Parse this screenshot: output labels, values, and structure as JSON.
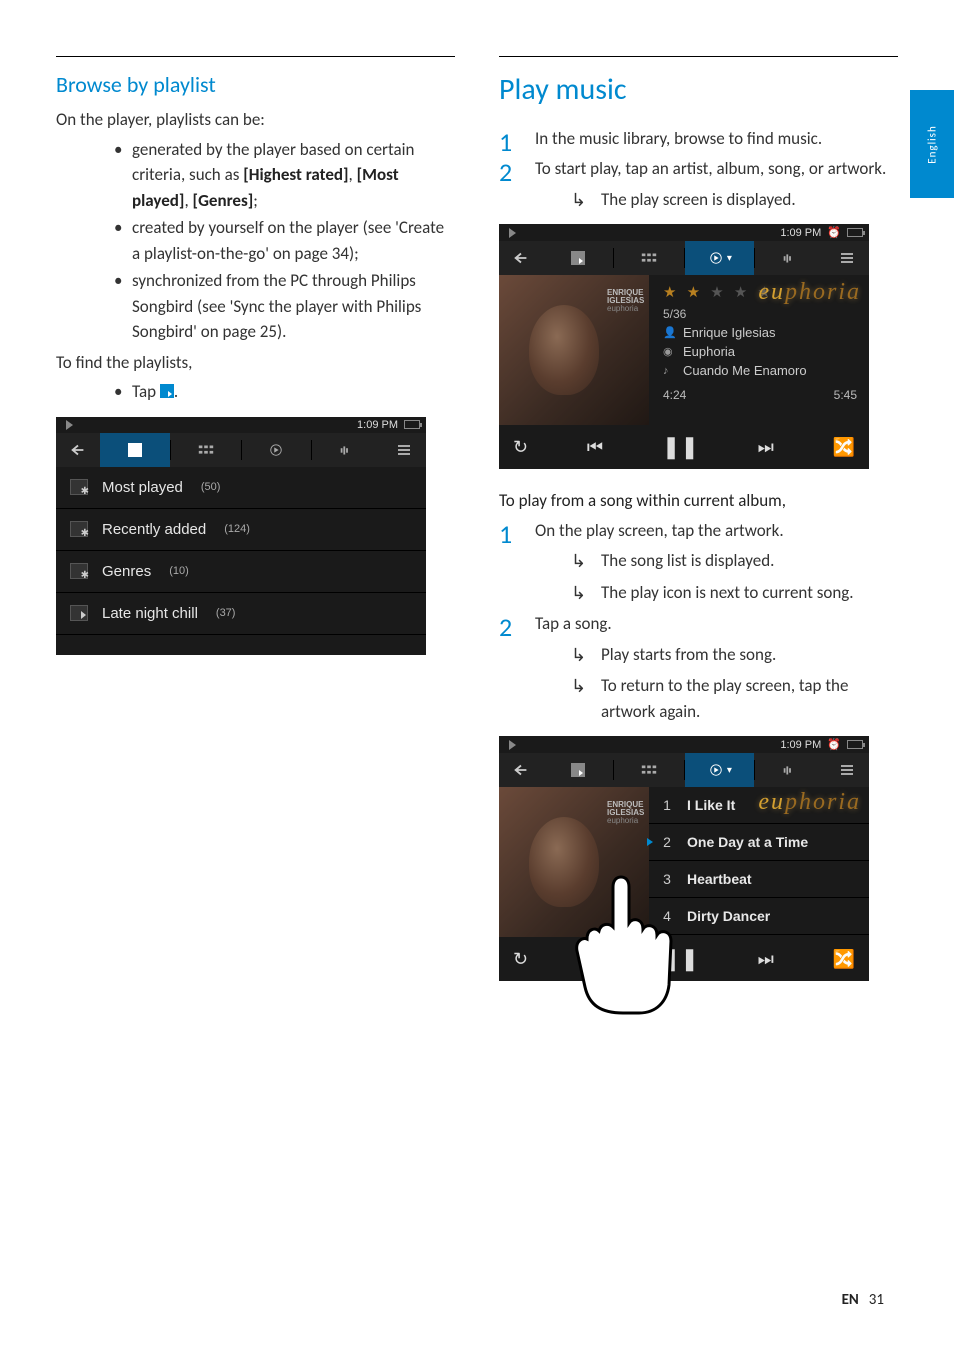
{
  "lang_tab": "English",
  "left": {
    "title": "Browse by playlist",
    "intro": "On the player, playlists can be:",
    "bullets": [
      {
        "pre": "generated by the player based on certain criteria, such as ",
        "bold": "[Highest rated]",
        "mid": ", ",
        "bold2": "[Most played]",
        "mid2": ", ",
        "bold3": "[Genres]",
        "post": ";"
      },
      {
        "text": "created by yourself on the player (see 'Create a playlist-on-the-go' on page 34);"
      },
      {
        "text": "synchronized from the PC through Philips Songbird (see 'Sync the player with Philips Songbird' on page 25)."
      }
    ],
    "find_label": "To find the playlists,",
    "tap_label": "Tap ",
    "screenshot": {
      "time": "1:09 PM",
      "items": [
        {
          "name": "Most played",
          "count": "(50)",
          "type": "gear"
        },
        {
          "name": "Recently added",
          "count": "(124)",
          "type": "gear"
        },
        {
          "name": "Genres",
          "count": "(10)",
          "type": "gear"
        },
        {
          "name": "Late night chill",
          "count": "(37)",
          "type": "plain"
        }
      ]
    }
  },
  "right": {
    "title": "Play music",
    "step1": "In the music library, browse to find music.",
    "step2": "To start play, tap an artist, album, song, or artwork.",
    "step2_result": "The play screen is displayed.",
    "play_screenshot": {
      "time": "1:09 PM",
      "album_artist_sm1": "ENRIQUE",
      "album_artist_sm2": "IGLESIAS",
      "album_sub": "euphoria",
      "watermark": "euphoria",
      "track_pos": "5/36",
      "artist": "Enrique Iglesias",
      "album": "Euphoria",
      "song": "Cuando Me Enamoro",
      "elapsed": "4:24",
      "total": "5:45"
    },
    "section2_title": "To play from a song within current album,",
    "s2_step1": "On the play screen, tap the artwork.",
    "s2_step1_r1": "The song list is displayed.",
    "s2_step1_r2": "The play icon is next to current song.",
    "s2_step2": "Tap a song.",
    "s2_step2_r1": "Play starts from the song.",
    "s2_step2_r2": "To return to the play screen, tap the artwork again.",
    "songlist_screenshot": {
      "time": "1:09 PM",
      "songs": [
        {
          "n": "1",
          "t": "I Like It"
        },
        {
          "n": "2",
          "t": "One Day at a Time",
          "playing": true
        },
        {
          "n": "3",
          "t": "Heartbeat"
        },
        {
          "n": "4",
          "t": "Dirty Dancer"
        }
      ]
    }
  },
  "footer": {
    "lang": "EN",
    "page": "31"
  }
}
